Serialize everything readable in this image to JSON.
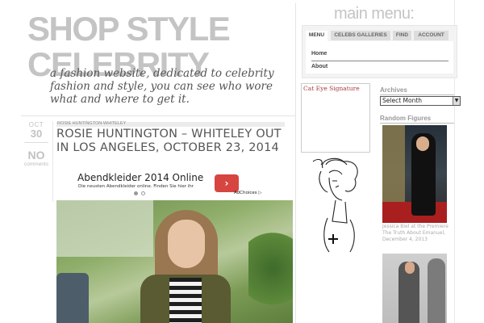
{
  "site": {
    "title": "SHOP STYLE CELEBRITY",
    "tagline": "a fashion website, dedicated to celebrity fashion and style, you can see who wore what and where to get it."
  },
  "post": {
    "month": "OCT",
    "day": "30",
    "comments_count": "NO",
    "comments_label": "comments",
    "category": "ROSIE HUNTINGTON-WHITELEY",
    "title": "ROSIE HUNTINGTON – WHITELEY OUT IN LOS ANGELES, OCTOBER 23, 2014"
  },
  "ad": {
    "title": "Abendkleider 2014 Online",
    "text": "Die neusten Abendkleider online. Finden Sie hier ihr",
    "arrow": "›",
    "choices": "AdChoices ▷"
  },
  "menu": {
    "heading": "main menu:",
    "tabs": [
      {
        "label": "MENU",
        "active": true
      },
      {
        "label": "CELEBS GALLERIES",
        "active": false
      },
      {
        "label": "FIND",
        "active": false
      },
      {
        "label": "ACCOUNT",
        "active": false
      }
    ],
    "items": [
      {
        "label": "Home"
      },
      {
        "label": "About"
      }
    ]
  },
  "sidebar": {
    "cateye_title": "Cat Eye Signature",
    "archives_title": "Archives",
    "archives_select_value": "Select Month",
    "random_title": "Random Figures",
    "figure_captions": [
      "Jessica Biel at the Premiere The Truth About Emanuel, December 4, 2013"
    ]
  },
  "colors": {
    "accent": "#d64540",
    "title_gray": "#c4c4c4",
    "red_carpet": "#a91f1f"
  },
  "icons": {
    "ad_arrow": "chevron-right-icon",
    "select_arrow": "chevron-down-icon",
    "sketch_plus": "plus-icon"
  }
}
